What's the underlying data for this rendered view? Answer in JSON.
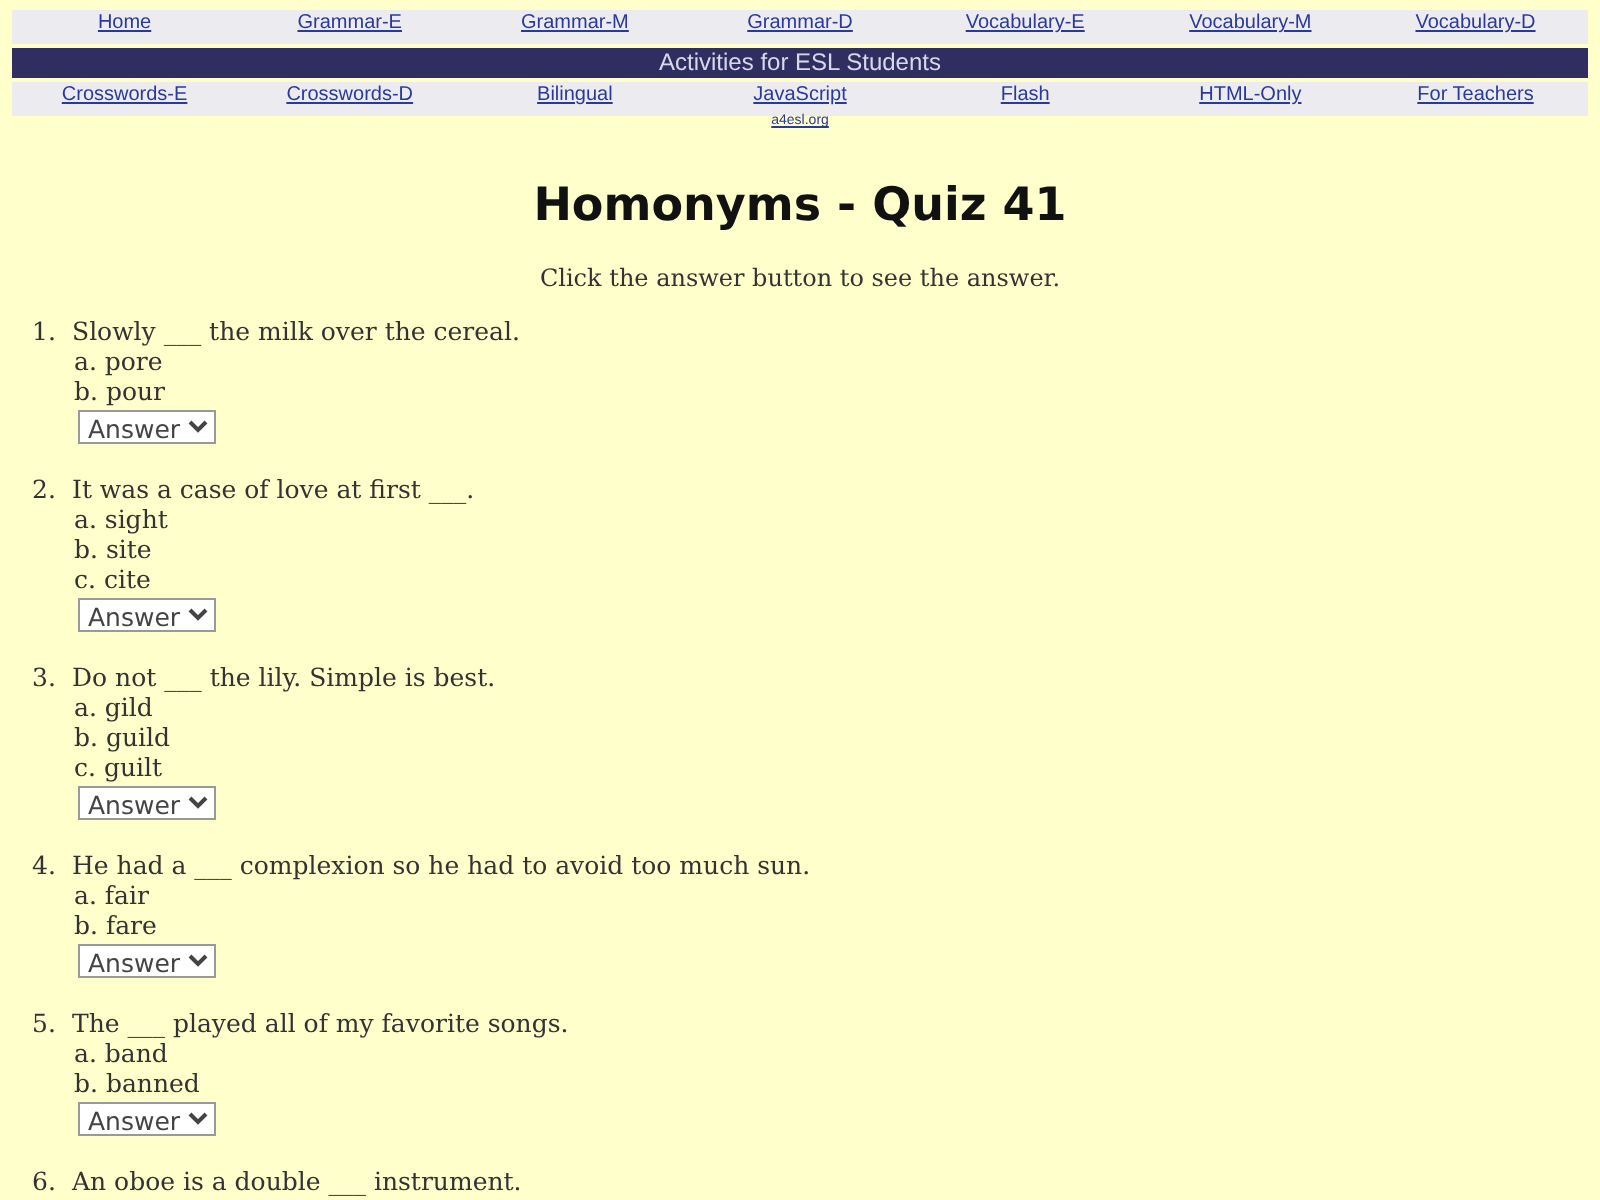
{
  "nav_top": [
    "Home",
    "Grammar-E",
    "Grammar-M",
    "Grammar-D",
    "Vocabulary-E",
    "Vocabulary-M",
    "Vocabulary-D"
  ],
  "banner": "Activities for ESL Students",
  "nav_bottom": [
    "Crosswords-E",
    "Crosswords-D",
    "Bilingual",
    "JavaScript",
    "Flash",
    "HTML-Only",
    "For Teachers"
  ],
  "site_link": "a4esl.org",
  "title": "Homonyms - Quiz 41",
  "instructions": "Click the answer button to see the answer.",
  "questions": [
    {
      "number": "1.",
      "text": "Slowly ___ the milk over the cereal.",
      "options": [
        "a. pore",
        "b. pour"
      ],
      "answer_button": "Answer"
    },
    {
      "number": "2.",
      "text": "It was a case of love at first ___.",
      "options": [
        "a. sight",
        "b. site",
        "c. cite"
      ],
      "answer_button": "Answer"
    },
    {
      "number": "3.",
      "text": "Do not ___ the lily. Simple is best.",
      "options": [
        "a. gild",
        "b. guild",
        "c. guilt"
      ],
      "answer_button": "Answer"
    },
    {
      "number": "4.",
      "text": "He had a ___ complexion so he had to avoid too much sun.",
      "options": [
        "a. fair",
        "b. fare"
      ],
      "answer_button": "Answer"
    },
    {
      "number": "5.",
      "text": "The ___ played all of my favorite songs.",
      "options": [
        "a. band",
        "b. banned"
      ],
      "answer_button": "Answer"
    },
    {
      "number": "6.",
      "text": "An oboe is a double ___ instrument."
    }
  ]
}
